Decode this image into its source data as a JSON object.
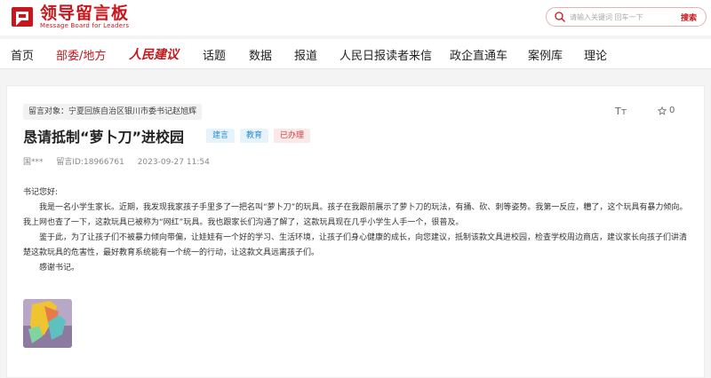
{
  "brand": {
    "name_cn": "领导留言板",
    "name_en": "Message Board for Leaders",
    "color": "#c8161d"
  },
  "search": {
    "placeholder": "请输入关键词 回车一下",
    "button_label": "搜索"
  },
  "nav": {
    "items": [
      {
        "label": "首页"
      },
      {
        "label": "部委/地方",
        "active": true
      },
      {
        "label": "人民建议"
      },
      {
        "label": "话题"
      },
      {
        "label": "数据"
      },
      {
        "label": "报道"
      },
      {
        "label": "人民日报读者来信"
      },
      {
        "label": "政企直通车"
      },
      {
        "label": "案例库"
      },
      {
        "label": "理论"
      }
    ]
  },
  "message": {
    "target": "留言对象：宁夏回族自治区银川市委书记赵旭辉",
    "font_icon_label": "Tт",
    "star_count": "0",
    "title": "恳请抵制“萝卜刀”进校园",
    "tags": [
      "建言",
      "教育",
      "已办理"
    ],
    "author": "国***",
    "id": "留言ID:18966761",
    "datetime": "2023-09-27 11:54",
    "greeting": "书记您好:",
    "paragraphs": [
      "我是一名小学生家长。近期，我发现我家孩子手里多了一把名叫“萝卜刀”的玩具。孩子在我跟前展示了萝卜刀的玩法，有捅、砍、刺等姿势。我第一反应，糟了，这个玩具有暴力倾向。我上网也查了一下，这款玩具已被称为“网红”玩具。我也跟家长们沟通了解了，这款玩具现在几乎小学生人手一个，很普及。",
      "鉴于此，为了让孩子们不被暴力倾向带偏，让娃娃有一个好的学习、生活环境，让孩子们身心健康的成长，向您建议，抵制该款文具进校园，检查学校周边商店，建议家长向孩子们讲清楚这款玩具的危害性，最好教育系统能有一个统一的行动，让这款文具远离孩子们。"
    ],
    "closing": "感谢书记。"
  }
}
